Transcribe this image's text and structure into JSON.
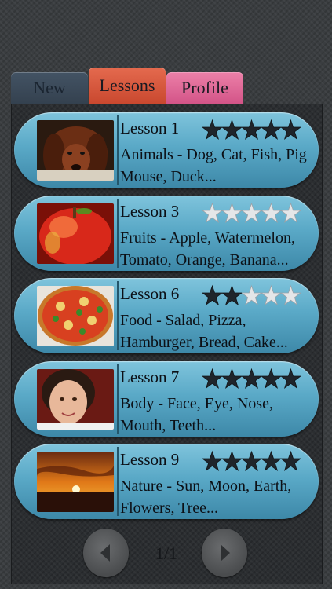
{
  "tabs": {
    "new": "New",
    "lessons": "Lessons",
    "profile": "Profile"
  },
  "lessons": [
    {
      "title": "Lesson 1",
      "desc": "Animals - Dog, Cat, Fish, Pig\nMouse, Duck...",
      "rating": 5,
      "image": "dog-photo"
    },
    {
      "title": "Lesson 3",
      "desc": "Fruits - Apple, Watermelon,\nTomato, Orange, Banana...",
      "rating": 0,
      "image": "apple-photo"
    },
    {
      "title": "Lesson 6",
      "desc": "Food - Salad, Pizza,\nHamburger, Bread, Cake...",
      "rating": 2,
      "image": "pizza-photo"
    },
    {
      "title": "Lesson 7",
      "desc": "Body - Face, Eye, Nose,\nMouth, Teeth...",
      "rating": 5,
      "image": "child-face-photo"
    },
    {
      "title": "Lesson 9",
      "desc": "Nature - Sun, Moon, Earth,\nFlowers, Tree...",
      "rating": 5,
      "image": "sunset-photo"
    }
  ],
  "pager": {
    "page": "1/1",
    "prev_icon": "chevron-left-icon",
    "next_icon": "chevron-right-icon"
  },
  "colors": {
    "filled_star": "#1f252b",
    "empty_star": "#e4e6e8",
    "lesson_bg": "#5aa9c7"
  }
}
